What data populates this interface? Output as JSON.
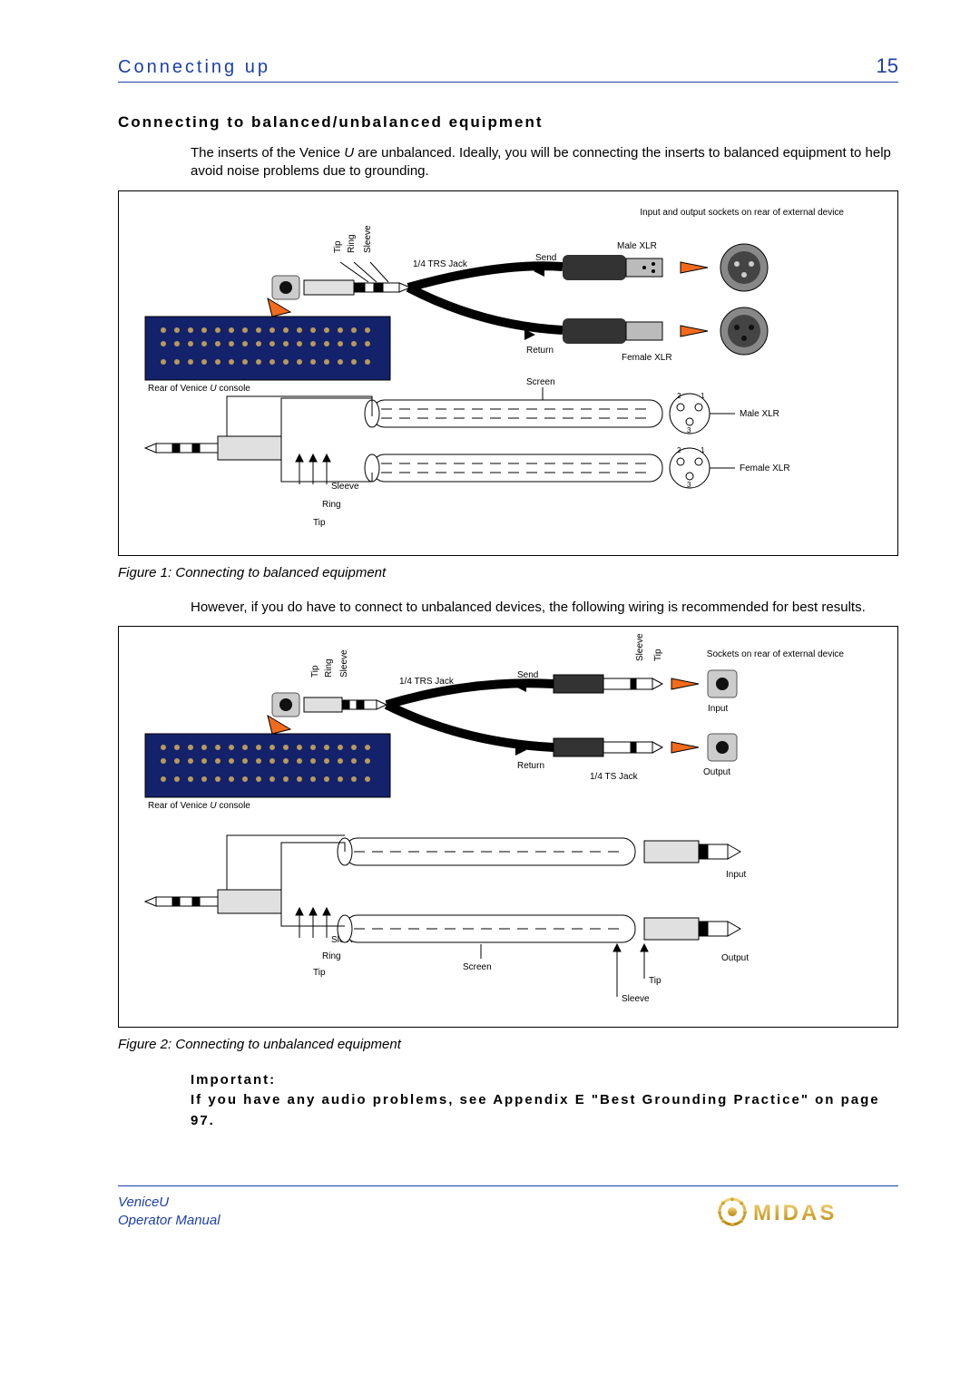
{
  "header": {
    "title": "Connecting up",
    "page": "15"
  },
  "section": {
    "heading": "Connecting to balanced/unbalanced equipment",
    "p1a": "The inserts of the Venice",
    "p1u": "U",
    "p1b": " are unbalanced.  Ideally, you will be connecting the inserts to balanced equipment to help avoid noise problems due to grounding.",
    "p2": "However, if you do have to connect to unbalanced devices, the following wiring is recommended for best results.",
    "important_label": "Important:",
    "important_text": "If you have any audio problems, see Appendix E \"Best Grounding Practice\" on page 97."
  },
  "fig1": {
    "caption": "Figure 1: Connecting to balanced equipment",
    "labels": {
      "tip": "Tip",
      "ring": "Ring",
      "sleeve": "Sleeve",
      "jack": "1/4  TRS Jack",
      "send": "Send",
      "return": "Return",
      "maleXLR": "Male XLR",
      "femaleXLR": "Female XLR",
      "inout": "Input and output sockets on rear of external device",
      "rear": "Rear of Venice",
      "rearU": "U",
      "rearC": " console",
      "screen": "Screen",
      "pins": {
        "p1": "1",
        "p2": "2",
        "p3": "3"
      }
    }
  },
  "fig2": {
    "caption": "Figure 2: Connecting to unbalanced equipment",
    "labels": {
      "tip": "Tip",
      "ring": "Ring",
      "sleeve": "Sleeve",
      "trs": "1/4  TRS Jack",
      "ts": "1/4  TS Jack",
      "send": "Send",
      "return": "Return",
      "input": "Input",
      "output": "Output",
      "sockets": "Sockets on rear of external device",
      "rear": "Rear of Venice",
      "rearU": "U",
      "rearC": " console",
      "screen": "Screen"
    }
  },
  "footer": {
    "product": "VeniceU",
    "doc": "Operator Manual",
    "brand": "MIDAS"
  }
}
